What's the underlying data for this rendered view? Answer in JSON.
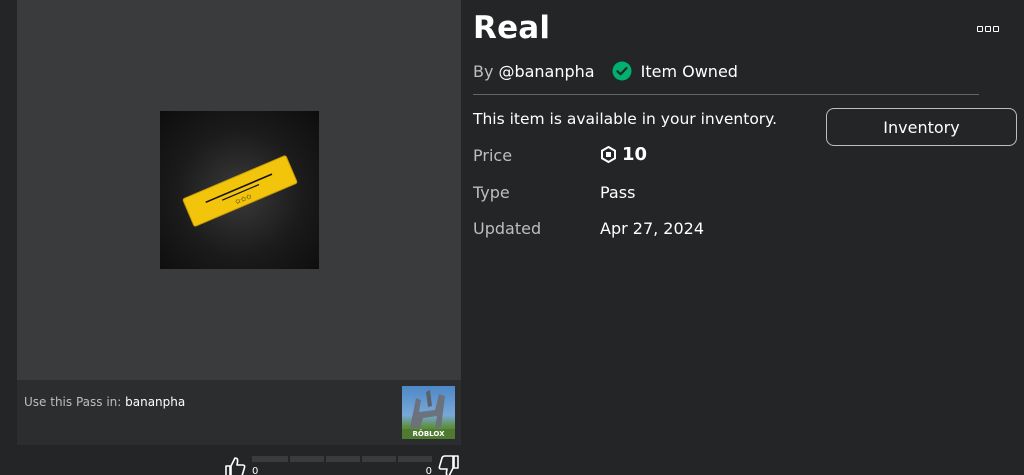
{
  "item": {
    "title": "Real",
    "by_label": "By",
    "creator": "@bananpha",
    "owned_label": "Item Owned",
    "available_text": "This item is available in your inventory.",
    "inventory_button": "Inventory"
  },
  "details": {
    "price_label": "Price",
    "price_value": "10",
    "type_label": "Type",
    "type_value": "Pass",
    "updated_label": "Updated",
    "updated_value": "Apr 27, 2024"
  },
  "place": {
    "use_text": "Use this Pass in:",
    "place_name": "bananpha",
    "thumb_brand": "RŌBLOX"
  },
  "votes": {
    "up_count": "0",
    "down_count": "0"
  },
  "icons": {
    "menu": "more-options-icon",
    "owned": "check-circle-icon",
    "currency": "robux-icon",
    "thumbs_up": "thumbs-up-icon",
    "thumbs_down": "thumbs-down-icon"
  },
  "colors": {
    "background": "#232527",
    "panel": "#393b3d",
    "owned_green": "#00b06f",
    "ticket_gold": "#f2c40b"
  }
}
